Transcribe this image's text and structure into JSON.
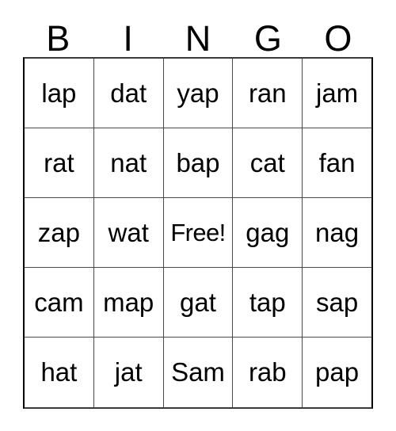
{
  "card": {
    "title_letters": [
      "B",
      "I",
      "N",
      "G",
      "O"
    ],
    "rows": [
      [
        "lap",
        "dat",
        "yap",
        "ran",
        "jam"
      ],
      [
        "rat",
        "nat",
        "bap",
        "cat",
        "fan"
      ],
      [
        "zap",
        "wat",
        "Free!",
        "gag",
        "nag"
      ],
      [
        "cam",
        "map",
        "gat",
        "tap",
        "sap"
      ],
      [
        "hat",
        "jat",
        "Sam",
        "rab",
        "pap"
      ]
    ],
    "free_space": {
      "row": 2,
      "col": 2,
      "label": "Free!"
    },
    "colors": {
      "background": "#ffffff",
      "text": "#000000",
      "outer_border": "#000000",
      "inner_border": "#4a4a4a"
    }
  }
}
